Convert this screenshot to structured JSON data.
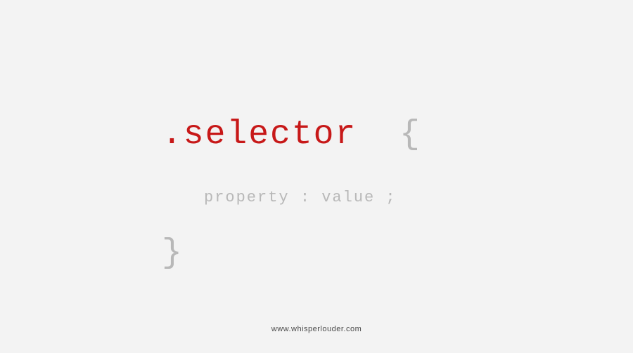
{
  "css_syntax": {
    "selector": ".selector",
    "brace_open": "{",
    "declaration": "property : value ;",
    "brace_close": "}"
  },
  "footer": {
    "url": "www.whisperlouder.com"
  }
}
